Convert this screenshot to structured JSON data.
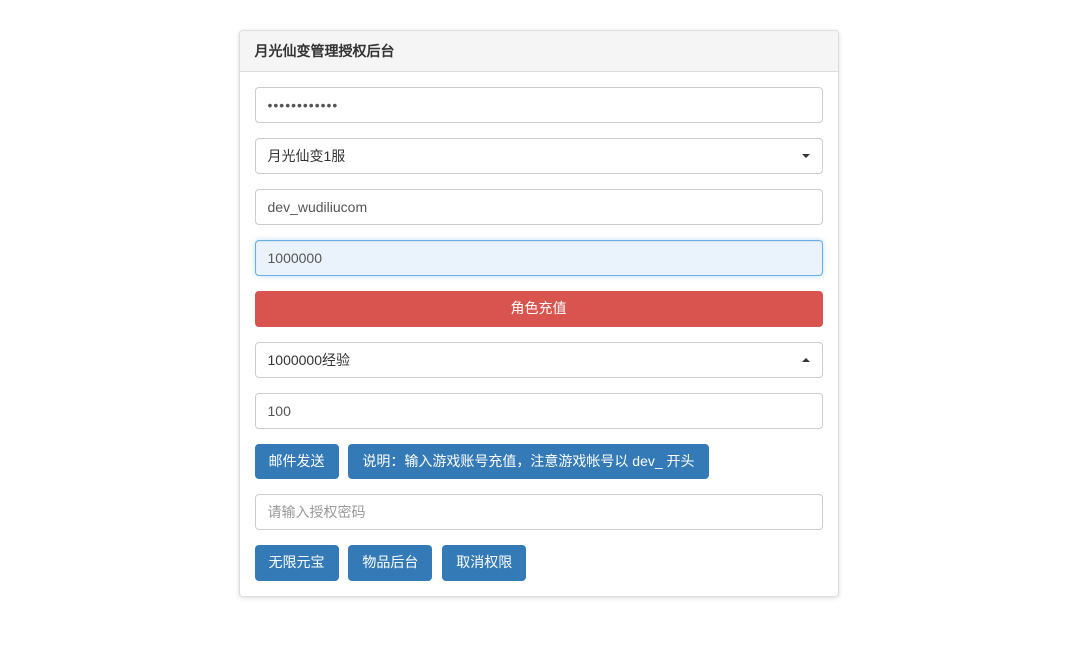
{
  "panel": {
    "title": "月光仙变管理授权后台"
  },
  "fields": {
    "password_value": "••••••••••••",
    "server_selected": "月光仙变1服",
    "account_value": "dev_wudiliucom",
    "amount_value": "1000000",
    "exp_selected": "1000000经验",
    "quantity_value": "100",
    "auth_placeholder": "请输入授权密码"
  },
  "buttons": {
    "recharge": "角色充值",
    "mail_send": "邮件发送",
    "instruction": "说明：输入游戏账号充值，注意游戏帐号以 dev_ 开头",
    "unlimited_gold": "无限元宝",
    "item_admin": "物品后台",
    "cancel_auth": "取消权限"
  }
}
